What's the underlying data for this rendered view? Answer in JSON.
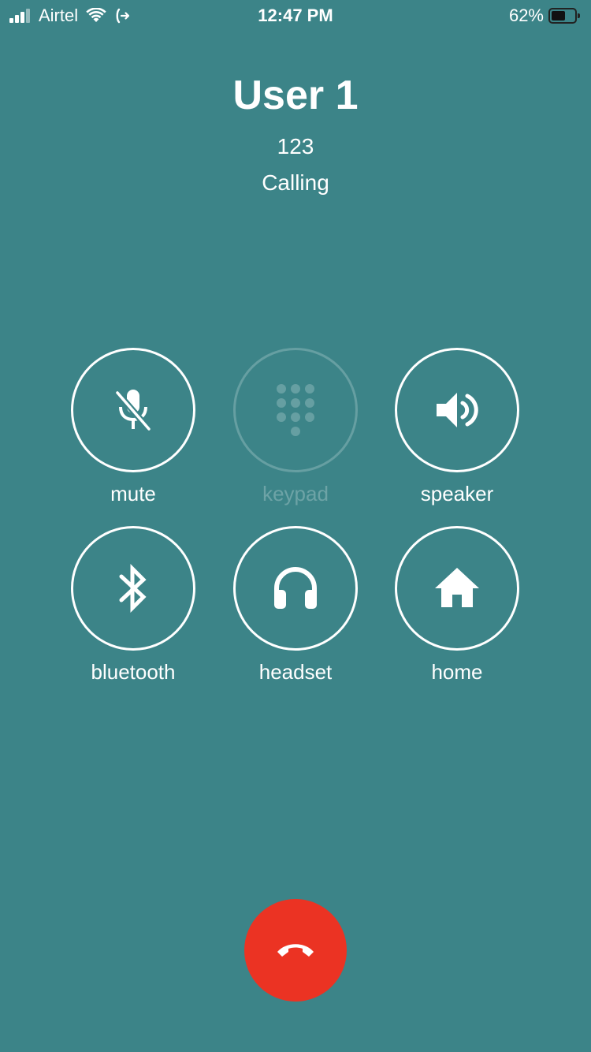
{
  "status_bar": {
    "carrier": "Airtel",
    "time": "12:47 PM",
    "battery_percent": "62%",
    "battery_level": 0.62,
    "signal_bars": 3,
    "icons": [
      "signal-icon",
      "wifi-icon",
      "call-forward-icon",
      "battery-icon"
    ]
  },
  "call": {
    "name": "User 1",
    "number": "123",
    "status": "Calling"
  },
  "controls": [
    {
      "label": "mute",
      "icon": "mic-off-icon",
      "enabled": true
    },
    {
      "label": "keypad",
      "icon": "keypad-icon",
      "enabled": false
    },
    {
      "label": "speaker",
      "icon": "speaker-icon",
      "enabled": true
    },
    {
      "label": "bluetooth",
      "icon": "bluetooth-icon",
      "enabled": true
    },
    {
      "label": "headset",
      "icon": "headset-icon",
      "enabled": true
    },
    {
      "label": "home",
      "icon": "home-icon",
      "enabled": true
    }
  ],
  "end_call": {
    "icon": "hang-up-icon"
  },
  "colors": {
    "background": "#3c8488",
    "end_call": "#eb3323",
    "foreground": "#ffffff"
  }
}
